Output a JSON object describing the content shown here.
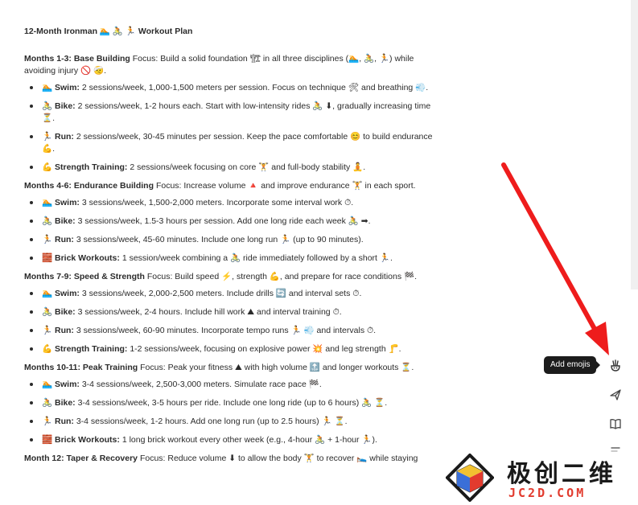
{
  "document": {
    "title": "12-Month Ironman 🏊 🚴 🏃 Workout Plan",
    "sections": [
      {
        "heading": "Months 1-3: Base Building",
        "focus": "Focus: Build a solid foundation 🏗 in all three disciplines (🏊, 🚴, 🏃) while avoiding injury 🚫 🤕.",
        "items": [
          {
            "label": "🏊 Swim:",
            "text": "2 sessions/week, 1,000-1,500 meters per session. Focus on technique 🛠 and breathing 💨."
          },
          {
            "label": "🚴 Bike:",
            "text": "2 sessions/week, 1-2 hours each. Start with low-intensity rides 🚴 ⬇, gradually increasing time ⏳."
          },
          {
            "label": "🏃 Run:",
            "text": "2 sessions/week, 30-45 minutes per session. Keep the pace comfortable 😊 to build endurance 💪."
          },
          {
            "label": "💪 Strength Training:",
            "text": "2 sessions/week focusing on core 🏋 and full-body stability 🧘."
          }
        ]
      },
      {
        "heading": "Months 4-6: Endurance Building",
        "focus": "Focus: Increase volume 🔺 and improve endurance 🏋 in each sport.",
        "items": [
          {
            "label": "🏊 Swim:",
            "text": "3 sessions/week, 1,500-2,000 meters. Incorporate some interval work ⏱."
          },
          {
            "label": "🚴 Bike:",
            "text": "3 sessions/week, 1.5-3 hours per session. Add one long ride each week 🚴 ➡."
          },
          {
            "label": "🏃 Run:",
            "text": "3 sessions/week, 45-60 minutes. Include one long run 🏃 (up to 90 minutes)."
          },
          {
            "label": "🧱 Brick Workouts:",
            "text": "1 session/week combining a 🚴 ride immediately followed by a short 🏃."
          }
        ]
      },
      {
        "heading": "Months 7-9: Speed & Strength",
        "focus": "Focus: Build speed ⚡, strength 💪, and prepare for race conditions 🏁.",
        "items": [
          {
            "label": "🏊 Swim:",
            "text": "3 sessions/week, 2,000-2,500 meters. Include drills 🔄 and interval sets ⏱."
          },
          {
            "label": "🚴 Bike:",
            "text": "3 sessions/week, 2-4 hours. Include hill work ⛰ and interval training ⏱."
          },
          {
            "label": "🏃 Run:",
            "text": "3 sessions/week, 60-90 minutes. Incorporate tempo runs 🏃 💨 and intervals ⏱."
          },
          {
            "label": "💪 Strength Training:",
            "text": "1-2 sessions/week, focusing on explosive power 💥 and leg strength 🦵."
          }
        ]
      },
      {
        "heading": "Months 10-11: Peak Training",
        "focus": "Focus: Peak your fitness ⛰ with high volume 🔝 and longer workouts ⏳.",
        "items": [
          {
            "label": "🏊 Swim:",
            "text": "3-4 sessions/week, 2,500-3,000 meters. Simulate race pace 🏁."
          },
          {
            "label": "🚴 Bike:",
            "text": "3-4 sessions/week, 3-5 hours per ride. Include one long ride (up to 6 hours) 🚴 ⏳."
          },
          {
            "label": "🏃 Run:",
            "text": "3-4 sessions/week, 1-2 hours. Add one long run (up to 2.5 hours) 🏃 ⏳."
          },
          {
            "label": "🧱 Brick Workouts:",
            "text": "1 long brick workout every other week (e.g., 4-hour 🚴 + 1-hour 🏃)."
          }
        ]
      },
      {
        "heading": "Month 12: Taper & Recovery",
        "focus": "Focus: Reduce volume ⬇ to allow the body 🏋 to recover 🛌 while staying",
        "items": []
      }
    ]
  },
  "tooltip": {
    "text": "Add emojis"
  },
  "toolbar": {
    "icons": [
      "add-emojis-icon",
      "paper-plane-icon",
      "book-icon",
      "adjust-length-icon"
    ]
  },
  "watermark": {
    "cn": "极创二维",
    "en": "JC2D.COM"
  },
  "colors": {
    "arrow": "#ee1c1c",
    "tooltip_bg": "#1c1c1c",
    "watermark_accent": "#e23b2e"
  }
}
